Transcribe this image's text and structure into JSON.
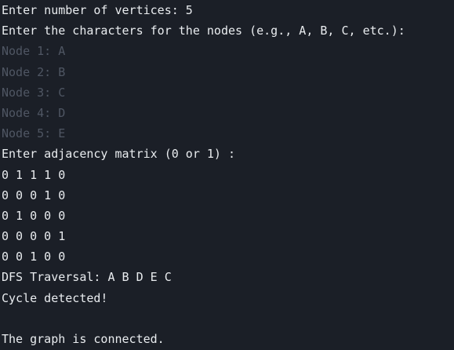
{
  "terminal": {
    "lines": [
      {
        "text": "Enter number of vertices: 5",
        "dim": false
      },
      {
        "text": "Enter the characters for the nodes (e.g., A, B, C, etc.):",
        "dim": false
      },
      {
        "text": "Node 1: A",
        "dim": true
      },
      {
        "text": "Node 2: B",
        "dim": true
      },
      {
        "text": "Node 3: C",
        "dim": true
      },
      {
        "text": "Node 4: D",
        "dim": true
      },
      {
        "text": "Node 5: E",
        "dim": true
      },
      {
        "text": "Enter adjacency matrix (0 or 1) :",
        "dim": false
      },
      {
        "text": "0 1 1 1 0",
        "dim": false
      },
      {
        "text": "0 0 0 1 0",
        "dim": false
      },
      {
        "text": "0 1 0 0 0",
        "dim": false
      },
      {
        "text": "0 0 0 0 1",
        "dim": false
      },
      {
        "text": "0 0 1 0 0",
        "dim": false
      },
      {
        "text": "DFS Traversal: A B D E C",
        "dim": false
      },
      {
        "text": "Cycle detected!",
        "dim": false
      },
      {
        "text": "",
        "dim": false
      },
      {
        "text": "The graph is connected.",
        "dim": false
      }
    ]
  },
  "colors": {
    "background": "#1b1f27",
    "foreground": "#e9ecef",
    "dim_text": "#4f5663"
  }
}
